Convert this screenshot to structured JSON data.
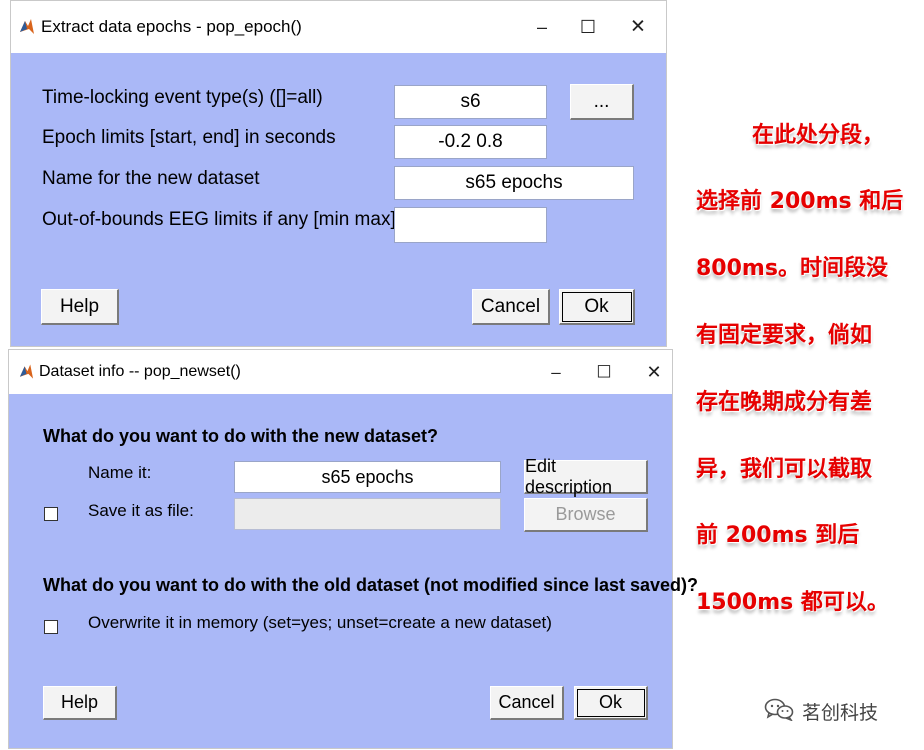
{
  "epoch_dialog": {
    "title": "Extract data epochs - pop_epoch()",
    "fields": [
      {
        "label": "Time-locking event type(s) ([]=all)",
        "value": "s6"
      },
      {
        "label": "Epoch limits [start, end] in seconds",
        "value": "-0.2 0.8"
      },
      {
        "label": "Name for the new dataset",
        "value": "s65 epochs"
      },
      {
        "label": "Out-of-bounds EEG limits if any [min max]",
        "value": ""
      }
    ],
    "browse_events_label": "...",
    "help_label": "Help",
    "cancel_label": "Cancel",
    "ok_label": "Ok"
  },
  "newset_dialog": {
    "title": "Dataset info -- pop_newset()",
    "section1_heading": "What do you want to do with the new dataset?",
    "name_label": "Name it:",
    "name_value": "s65 epochs",
    "edit_description_label": "Edit description",
    "save_label": "Save it as file:",
    "save_value": "",
    "browse_label": "Browse",
    "save_checked": false,
    "section2_heading": "What do you want to do with the old dataset (not modified since last saved)?",
    "overwrite_label": "Overwrite it in memory (set=yes; unset=create a new dataset)",
    "overwrite_checked": false,
    "help_label": "Help",
    "cancel_label": "Cancel",
    "ok_label": "Ok"
  },
  "window_controls": {
    "minimize": "–",
    "maximize": "☐",
    "close": "✕"
  },
  "annotation": {
    "color": "#e60000",
    "lines": [
      "在此处分段，",
      "选择前 200ms 和后",
      "800ms。时间段没",
      "有固定要求，倘如",
      "存在晚期成分有差",
      "异，我们可以截取",
      "前 200ms 到后",
      "1500ms 都可以。"
    ]
  },
  "watermark": {
    "text": "茗创科技",
    "icon": "wechat-icon"
  },
  "colors": {
    "dialog_bg": "#aab8f7",
    "button_bg": "#f3f3f3"
  }
}
